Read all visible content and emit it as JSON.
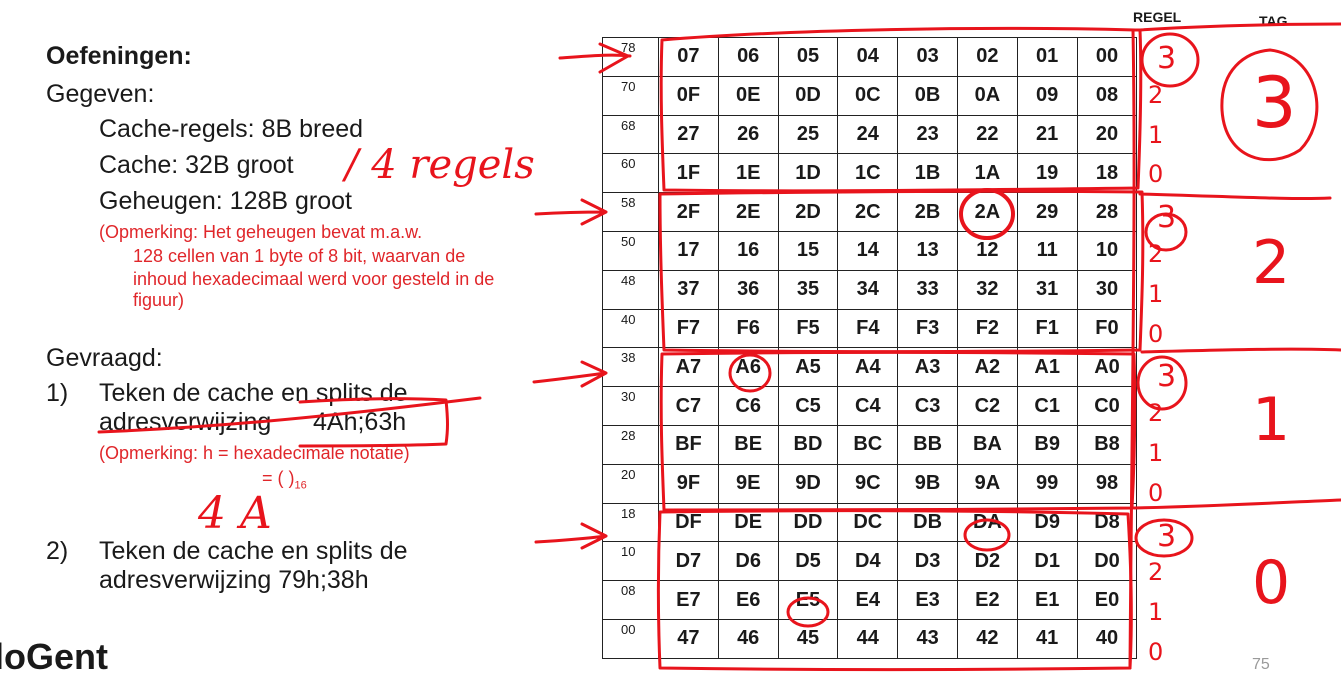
{
  "slide": {
    "title": "Oefeningen:",
    "given_label": "Gegeven:",
    "given": [
      "Cache-regels: 8B breed",
      "Cache: 32B groot",
      "Geheugen: 128B groot"
    ],
    "note1_lines": [
      "(Opmerking: Het geheugen bevat m.a.w.",
      "128 cellen van 1 byte of 8 bit, waarvan de",
      "inhoud hexadecimaal werd voor gesteld in de",
      "figuur)"
    ],
    "asked_label": "Gevraagd:",
    "q1_num": "1)",
    "q1_line1": "Teken de cache en splits de",
    "q1_line2": "adresverwijzing",
    "q1_addr": "4Ah;63h",
    "note2_line1": "(Opmerking: h   = hexadecimale notatie)",
    "note2_line2": "= (         )",
    "note2_sub": "16",
    "q2_num": "2)",
    "q2_line1": "Teken de cache en splits de",
    "q2_line2": "adresverwijzing 79h;38h",
    "logo": "loGent",
    "page_number": "75"
  },
  "table_headers": {
    "regel": "REGEL",
    "tag": "TAG"
  },
  "memory": [
    {
      "addr": "78",
      "cells": [
        "07",
        "06",
        "05",
        "04",
        "03",
        "02",
        "01",
        "00"
      ]
    },
    {
      "addr": "70",
      "cells": [
        "0F",
        "0E",
        "0D",
        "0C",
        "0B",
        "0A",
        "09",
        "08"
      ]
    },
    {
      "addr": "68",
      "cells": [
        "27",
        "26",
        "25",
        "24",
        "23",
        "22",
        "21",
        "20"
      ]
    },
    {
      "addr": "60",
      "cells": [
        "1F",
        "1E",
        "1D",
        "1C",
        "1B",
        "1A",
        "19",
        "18"
      ]
    },
    {
      "addr": "58",
      "cells": [
        "2F",
        "2E",
        "2D",
        "2C",
        "2B",
        "2A",
        "29",
        "28"
      ]
    },
    {
      "addr": "50",
      "cells": [
        "17",
        "16",
        "15",
        "14",
        "13",
        "12",
        "11",
        "10"
      ]
    },
    {
      "addr": "48",
      "cells": [
        "37",
        "36",
        "35",
        "34",
        "33",
        "32",
        "31",
        "30"
      ]
    },
    {
      "addr": "40",
      "cells": [
        "F7",
        "F6",
        "F5",
        "F4",
        "F3",
        "F2",
        "F1",
        "F0"
      ]
    },
    {
      "addr": "38",
      "cells": [
        "A7",
        "A6",
        "A5",
        "A4",
        "A3",
        "A2",
        "A1",
        "A0"
      ]
    },
    {
      "addr": "30",
      "cells": [
        "C7",
        "C6",
        "C5",
        "C4",
        "C3",
        "C2",
        "C1",
        "C0"
      ]
    },
    {
      "addr": "28",
      "cells": [
        "BF",
        "BE",
        "BD",
        "BC",
        "BB",
        "BA",
        "B9",
        "B8"
      ]
    },
    {
      "addr": "20",
      "cells": [
        "9F",
        "9E",
        "9D",
        "9C",
        "9B",
        "9A",
        "99",
        "98"
      ]
    },
    {
      "addr": "18",
      "cells": [
        "DF",
        "DE",
        "DD",
        "DC",
        "DB",
        "DA",
        "D9",
        "D8"
      ]
    },
    {
      "addr": "10",
      "cells": [
        "D7",
        "D6",
        "D5",
        "D4",
        "D3",
        "D2",
        "D1",
        "D0"
      ]
    },
    {
      "addr": "08",
      "cells": [
        "E7",
        "E6",
        "E5",
        "E4",
        "E3",
        "E2",
        "E1",
        "E0"
      ]
    },
    {
      "addr": "00",
      "cells": [
        "47",
        "46",
        "45",
        "44",
        "43",
        "42",
        "41",
        "40"
      ]
    }
  ],
  "handwriting": {
    "lines_note": "/ 4 regels",
    "answer": "4 A",
    "regel_digits": [
      "3",
      "2",
      "1",
      "0",
      "3",
      "2",
      "1",
      "0",
      "3",
      "2",
      "1",
      "0",
      "3",
      "2",
      "1",
      "0"
    ],
    "tags": [
      "3",
      "2",
      "1",
      "0"
    ],
    "ink_color": "#e8141c"
  }
}
